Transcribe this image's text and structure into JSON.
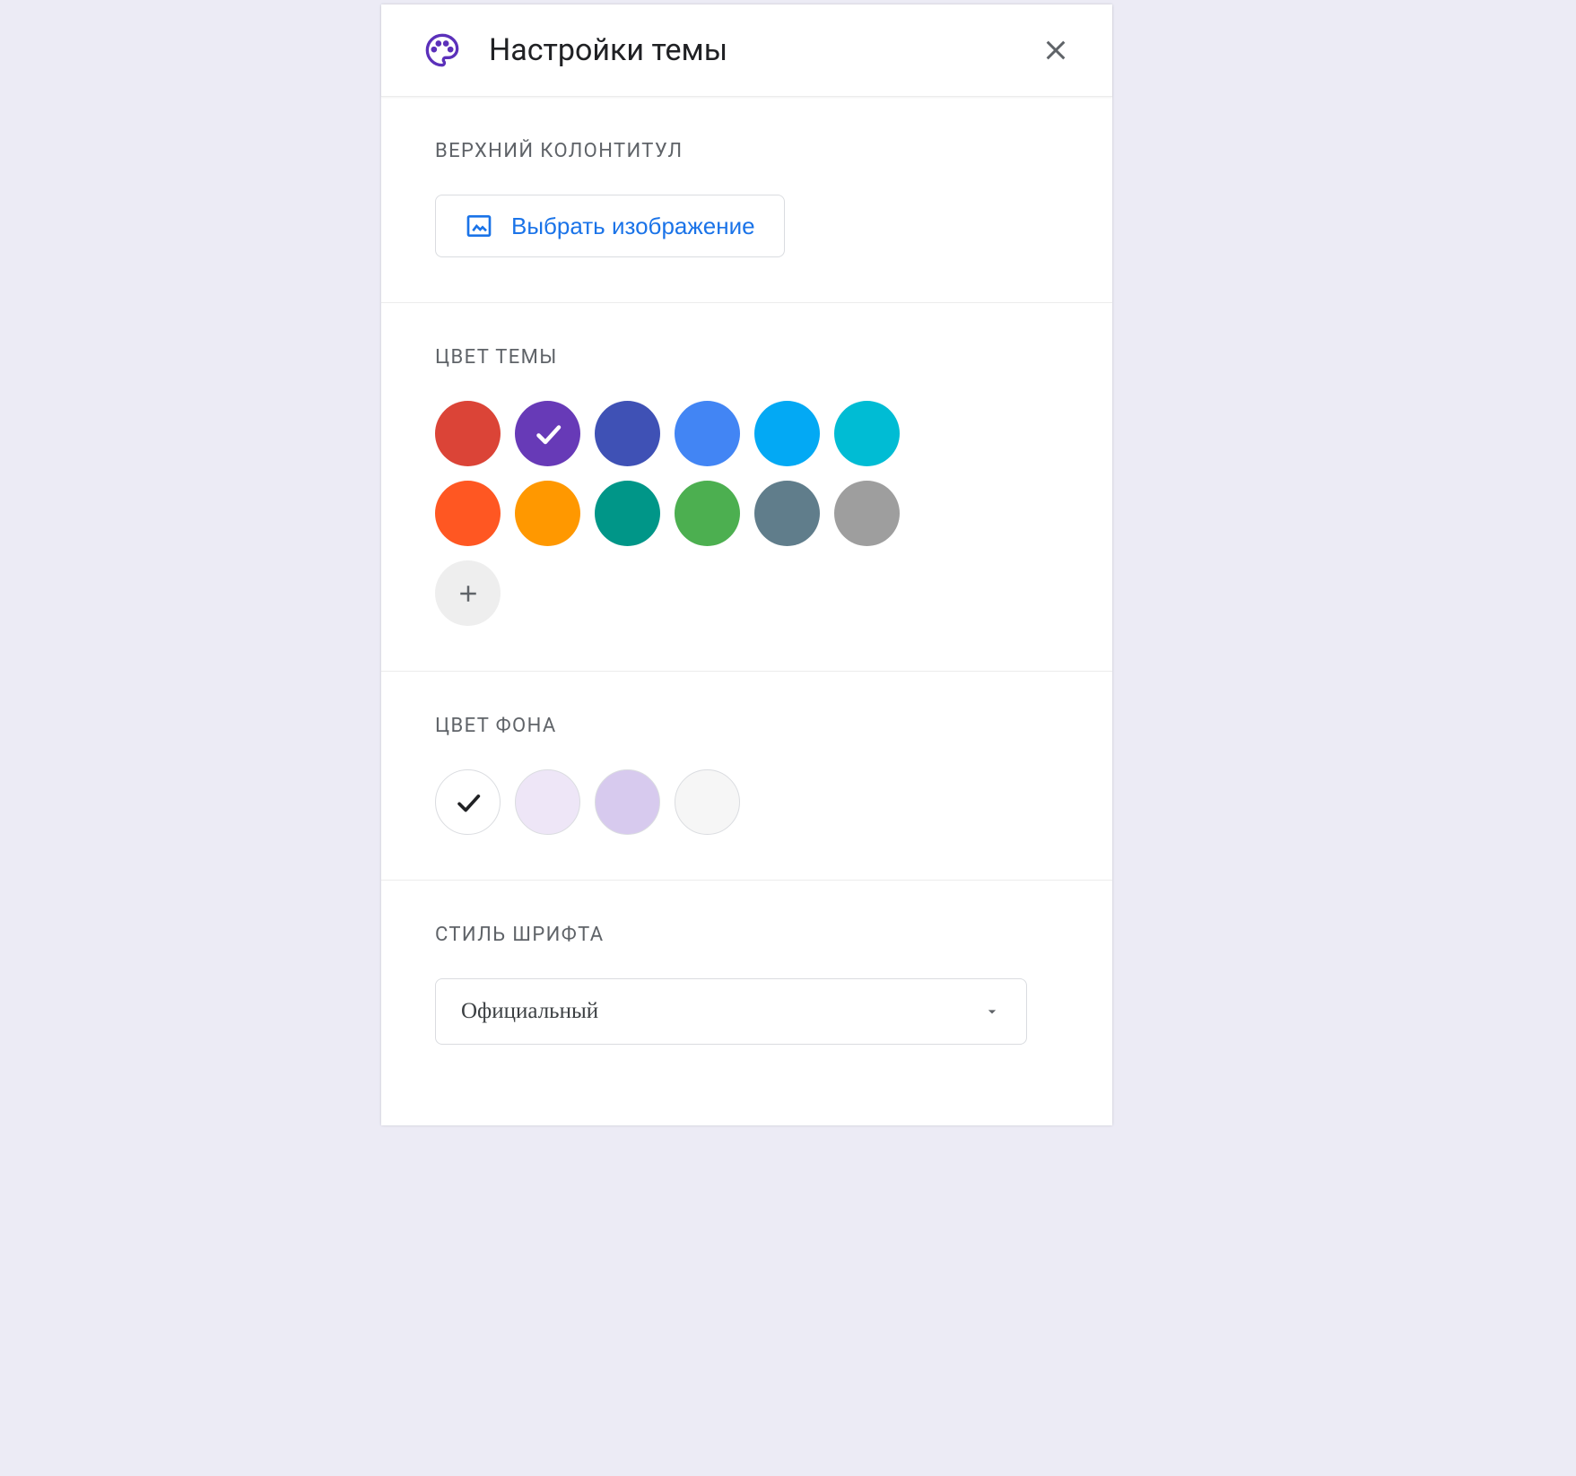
{
  "header": {
    "title": "Настройки темы"
  },
  "sections": {
    "header_image": {
      "label": "ВЕРХНИЙ КОЛОНТИТУЛ",
      "button_label": "Выбрать изображение"
    },
    "theme_color": {
      "label": "ЦВЕТ ТЕМЫ",
      "swatches": [
        {
          "color": "#db4437",
          "selected": false
        },
        {
          "color": "#673ab7",
          "selected": true
        },
        {
          "color": "#3f51b5",
          "selected": false
        },
        {
          "color": "#4285f4",
          "selected": false
        },
        {
          "color": "#03a9f4",
          "selected": false
        },
        {
          "color": "#00bcd4",
          "selected": false
        },
        {
          "color": "#ff5722",
          "selected": false
        },
        {
          "color": "#ff9800",
          "selected": false
        },
        {
          "color": "#009688",
          "selected": false
        },
        {
          "color": "#4caf50",
          "selected": false
        },
        {
          "color": "#607d8b",
          "selected": false
        },
        {
          "color": "#9e9e9e",
          "selected": false
        }
      ]
    },
    "background_color": {
      "label": "ЦВЕТ ФОНА",
      "swatches": [
        {
          "color": "#ffffff",
          "selected": true
        },
        {
          "color": "#eee6f7",
          "selected": false
        },
        {
          "color": "#d7caee",
          "selected": false
        },
        {
          "color": "#f6f6f6",
          "selected": false
        }
      ]
    },
    "font_style": {
      "label": "СТИЛЬ ШРИФТА",
      "selected": "Официальный"
    }
  }
}
